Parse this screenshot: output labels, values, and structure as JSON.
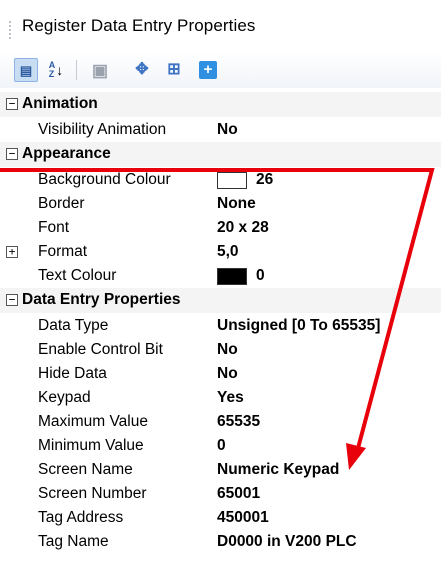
{
  "window": {
    "title": "Register Data Entry Properties"
  },
  "toolbar": {
    "buttons": [
      {
        "name": "categorized",
        "icon": "categorized-icon",
        "glyph": "▤"
      },
      {
        "name": "alphabetical",
        "icon": "sort-az-icon",
        "glyph": "↓"
      },
      {
        "name": "property-pages",
        "icon": "property-pages-icon",
        "glyph": "▣"
      },
      {
        "name": "expand",
        "icon": "expand-icon",
        "glyph": "✥"
      },
      {
        "name": "properties",
        "icon": "properties-icon",
        "glyph": "⊞"
      },
      {
        "name": "add",
        "icon": "add-icon",
        "glyph": "+"
      }
    ]
  },
  "grid": {
    "categories": {
      "animation": {
        "label": "Animation",
        "toggle": "−"
      },
      "appearance": {
        "label": "Appearance",
        "toggle": "−"
      },
      "data_entry": {
        "label": "Data Entry Properties",
        "toggle": "−"
      }
    },
    "props": {
      "visibility_animation": {
        "name": "Visibility Animation",
        "value": "No"
      },
      "background_colour": {
        "name": "Background Colour",
        "value": "26",
        "swatch": "#ffffff"
      },
      "border": {
        "name": "Border",
        "value": "None"
      },
      "font": {
        "name": "Font",
        "value": "20 x 28"
      },
      "format": {
        "name": "Format",
        "value": "5,0",
        "toggle": "+"
      },
      "text_colour": {
        "name": "Text Colour",
        "value": "0",
        "swatch": "#000000"
      },
      "data_type": {
        "name": "Data Type",
        "value": "Unsigned [0 To 65535]"
      },
      "enable_control_bit": {
        "name": "Enable Control Bit",
        "value": "No"
      },
      "hide_data": {
        "name": "Hide Data",
        "value": "No"
      },
      "keypad": {
        "name": "Keypad",
        "value": "Yes"
      },
      "maximum_value": {
        "name": "Maximum Value",
        "value": "65535"
      },
      "minimum_value": {
        "name": "Minimum Value",
        "value": "0"
      },
      "screen_name": {
        "name": "Screen Name",
        "value": "Numeric Keypad"
      },
      "screen_number": {
        "name": "Screen Number",
        "value": "65001"
      },
      "tag_address": {
        "name": "Tag Address",
        "value": "450001"
      },
      "tag_name": {
        "name": "Tag Name",
        "value": "D0000 in V200 PLC"
      }
    }
  },
  "annotation": {
    "color": "#e8000b"
  }
}
